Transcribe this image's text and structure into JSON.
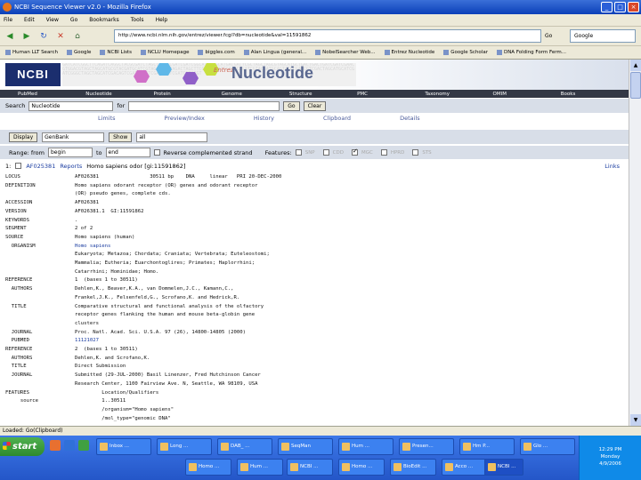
{
  "window": {
    "title": "NCBI Sequence Viewer v2.0 - Mozilla Firefox",
    "buttons": [
      "_",
      "□",
      "×"
    ]
  },
  "menu": [
    "File",
    "Edit",
    "View",
    "Go",
    "Bookmarks",
    "Tools",
    "Help"
  ],
  "nav": {
    "url": "http://www.ncbi.nlm.nih.gov/entrez/viewer.fcgi?db=nucleotide&val=11591862",
    "go_label": "Go",
    "search_engine": "Google"
  },
  "bookmarks": [
    "Human LLT Search",
    "Google",
    "NCBI Lists",
    "NCLU Homepage",
    "biggles.com",
    "Alan Lingua (general...",
    "NobelSearcher Web...",
    "Entrez Nucleotide",
    "Google Scholar",
    "DNA Folding Form Ferm..."
  ],
  "ncbi": {
    "logo": "NCBI",
    "entrez": "Entrez",
    "title": "Nucleotide",
    "dna_bg": "GATCATCGGCTTCAGATCAGGCTACGCGATCTAGCTTAGCCGATCGATCGGCATTCAGCATGACGACTCGCTAGCTAGCGTAGCATGCTGACTGACTGATCGATCGAACGTGGACGTAGCTAGCATGCGTACGATGCATCGTAGCTAGCTAGACTAGCTTCGATCGATGTCAGTCAGATCGTACGATGCAGTAGCCGATCGTCGACTAGCATGCATCGATCGGGCTAGCTAGCATCGACAGTCGATGCAGTCGATCGATCGATCGTACGT"
  },
  "db_links": [
    "PubMed",
    "Nucleotide",
    "Protein",
    "Genome",
    "Structure",
    "PMC",
    "Taxonomy",
    "OMIM",
    "Books"
  ],
  "search": {
    "label": "Search",
    "db": "Nucleotide",
    "for_label": "for",
    "go": "Go",
    "clear": "Clear"
  },
  "tabs": [
    "Limits",
    "Preview/Index",
    "History",
    "Clipboard",
    "Details"
  ],
  "controls": {
    "display_label": "Display",
    "format": "GenBank",
    "show_label": "Show",
    "show_value": "all",
    "send_label": "Send to",
    "send_value": "File"
  },
  "range": {
    "label": "Range: from",
    "from": "begin",
    "to_label": "to",
    "to": "end",
    "refresh": "Refresh",
    "reverse": "Reverse complemented strand",
    "features_label": "Features:",
    "features": [
      {
        "name": "SNP",
        "checked": false
      },
      {
        "name": "CDD",
        "checked": false
      },
      {
        "name": "MGC",
        "checked": true
      },
      {
        "name": "HPRD",
        "checked": false
      },
      {
        "name": "STS",
        "checked": false
      }
    ]
  },
  "record": {
    "index": "1:",
    "accession": "AF025381",
    "reports": "Reports",
    "description": "Homo sapiens odor [gi:11591862]",
    "links": "Links"
  },
  "genbank_lines": [
    {
      "k": "LOCUS",
      "v": "AF026381                 30511 bp    DNA     linear   PRI 20-DEC-2000"
    },
    {
      "k": "DEFINITION",
      "v": "Homo sapiens odorant receptor (OR) genes and odorant receptor"
    },
    {
      "k": "",
      "v": "(OR) pseudo genes, complete cds."
    },
    {
      "k": "ACCESSION",
      "v": "AF026381"
    },
    {
      "k": "VERSION",
      "v": "AF026381.1  GI:11591862"
    },
    {
      "k": "KEYWORDS",
      "v": "."
    },
    {
      "k": "SEGMENT",
      "v": "2 of 2"
    },
    {
      "k": "SOURCE",
      "v": "Homo sapiens (human)"
    },
    {
      "k": "  ORGANISM",
      "v": "Homo sapiens",
      "link": true
    },
    {
      "k": "",
      "v": "Eukaryota; Metazoa; Chordata; Craniata; Vertebrata; Euteleostomi;"
    },
    {
      "k": "",
      "v": "Mammalia; Eutheria; Euarchontoglires; Primates; Haplorrhini;"
    },
    {
      "k": "",
      "v": "Catarrhini; Hominidae; Homo."
    },
    {
      "k": "REFERENCE",
      "v": "1  (bases 1 to 30511)"
    },
    {
      "k": "  AUTHORS",
      "v": "Dehlen,K., Beaver,K.A., van Dommelen,J.C., Kamann,C.,"
    },
    {
      "k": "",
      "v": "Frankel,J.K., Felsenfeld,G., Scrofano,K. and Hedrick,R."
    },
    {
      "k": "  TITLE",
      "v": "Comparative structural and functional analysis of the olfactory"
    },
    {
      "k": "",
      "v": "receptor genes flanking the human and mouse beta-globin gene"
    },
    {
      "k": "",
      "v": "clusters"
    },
    {
      "k": "  JOURNAL",
      "v": "Proc. Natl. Acad. Sci. U.S.A. 97 (26), 14800-14805 (2000)"
    },
    {
      "k": "  PUBMED",
      "v": "11121027",
      "link": true
    },
    {
      "k": "REFERENCE",
      "v": "2  (bases 1 to 30511)"
    },
    {
      "k": "  AUTHORS",
      "v": "Dehlen,K. and Scrofano,K."
    },
    {
      "k": "  TITLE",
      "v": "Direct Submission"
    },
    {
      "k": "  JOURNAL",
      "v": "Submitted (29-JUL-2000) Basil Linenzer, Fred Hutchinson Cancer"
    },
    {
      "k": "",
      "v": "Research Center, 1100 Fairview Ave. N, Seattle, WA 98109, USA"
    },
    {
      "k": "FEATURES",
      "v": "         Location/Qualifiers"
    },
    {
      "k": "     source",
      "v": "         1..30511"
    },
    {
      "k": "",
      "v": "         /organism=\"Homo sapiens\""
    },
    {
      "k": "",
      "v": "         /mol_type=\"genomic DNA\""
    }
  ],
  "status": "Loaded: Go(Clipboard)",
  "taskbar": {
    "start": "start",
    "row1": [
      "Inbox ...",
      "Long ...",
      "DAB_ ...",
      "SeqMan",
      "Hum ...",
      "Presen...",
      "Hm P...",
      "Glo ..."
    ],
    "row2": [
      "Homo ...",
      "Hum ...",
      "NCBI ...",
      "Homo ...",
      "BioEdit ...",
      "Acco ...",
      "NCBI ..."
    ],
    "clock": "12:29 PM",
    "day": "Monday",
    "date": "4/9/2006"
  }
}
